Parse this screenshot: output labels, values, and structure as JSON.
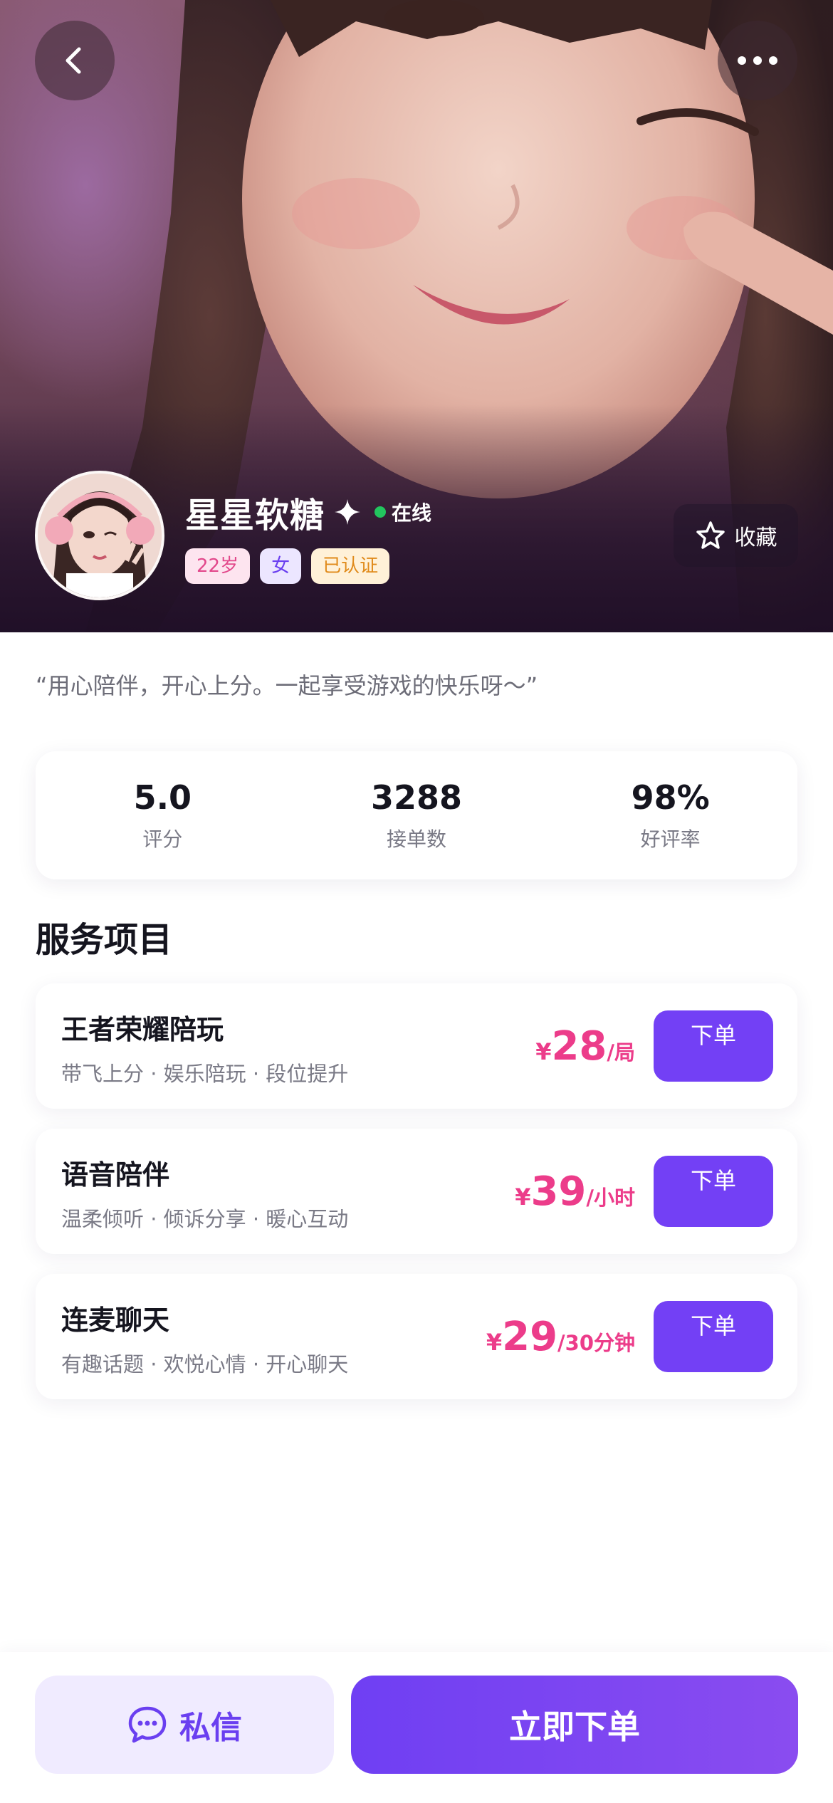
{
  "profile": {
    "name": "星星软糖",
    "status": "在线",
    "tags": {
      "age": "22岁",
      "gender": "女",
      "verified": "已认证"
    },
    "favorite_label": "收藏",
    "quote": "“用心陪伴，开心上分。一起享受游戏的快乐呀～”"
  },
  "stats": [
    {
      "value": "5.0",
      "label": "评分"
    },
    {
      "value": "3288",
      "label": "接单数"
    },
    {
      "value": "98%",
      "label": "好评率"
    }
  ],
  "services_title": "服务项目",
  "services": [
    {
      "name": "王者荣耀陪玩",
      "desc": "带飞上分 · 娱乐陪玩 · 段位提升",
      "currency": "¥",
      "price": "28",
      "unit": "/局",
      "button": "下单"
    },
    {
      "name": "语音陪伴",
      "desc": "温柔倾听 · 倾诉分享 · 暖心互动",
      "currency": "¥",
      "price": "39",
      "unit": "/小时",
      "button": "下单"
    },
    {
      "name": "连麦聊天",
      "desc": "有趣话题 · 欢悦心情 · 开心聊天",
      "currency": "¥",
      "price": "29",
      "unit": "/30分钟",
      "button": "下单"
    }
  ],
  "bottom_bar": {
    "message_label": "私信",
    "order_label": "立即下单"
  },
  "icons": {
    "back": "chevron-left-icon",
    "more": "more-horizontal-icon",
    "favorite": "star-outline-icon",
    "verified_sparkle": "sparkle-icon",
    "message": "chat-bubble-icon"
  },
  "colors": {
    "accent": "#7340f5",
    "price": "#ec3c8a",
    "online": "#22c55e"
  }
}
